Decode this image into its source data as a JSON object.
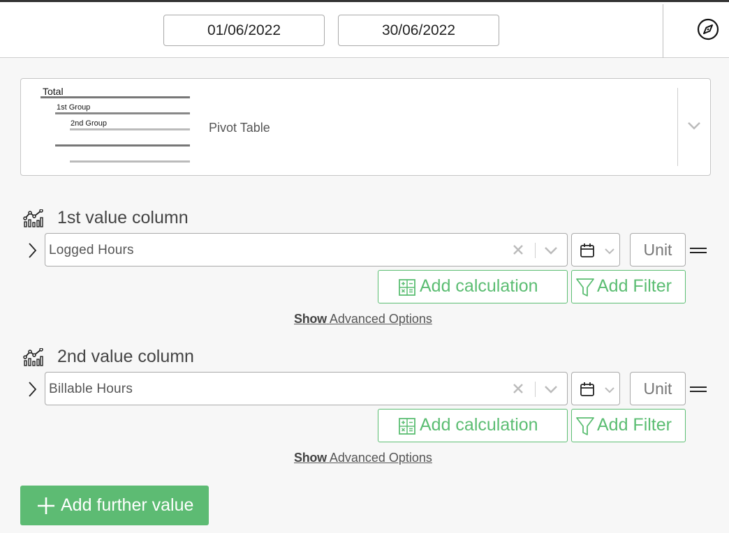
{
  "header": {
    "start_date": "01/06/2022",
    "end_date": "30/06/2022",
    "compass_icon": "compass-icon"
  },
  "pivot": {
    "preview": {
      "total": "Total",
      "group1": "1st Group",
      "group2": "2nd Group"
    },
    "name": "Pivot Table"
  },
  "columns": [
    {
      "title": "1st value column",
      "value": "Logged Hours",
      "unit_placeholder": "Unit",
      "add_calculation": "Add calculation",
      "add_filter": "Add Filter",
      "advanced_show": "Show",
      "advanced_options": "Advanced Options"
    },
    {
      "title": "2nd value column",
      "value": "Billable Hours",
      "unit_placeholder": "Unit",
      "add_calculation": "Add calculation",
      "add_filter": "Add Filter",
      "advanced_show": "Show",
      "advanced_options": "Advanced Options"
    }
  ],
  "add_further_value": "Add further value",
  "colors": {
    "accent_green": "#5dbb73",
    "border": "#a9a9a9"
  }
}
